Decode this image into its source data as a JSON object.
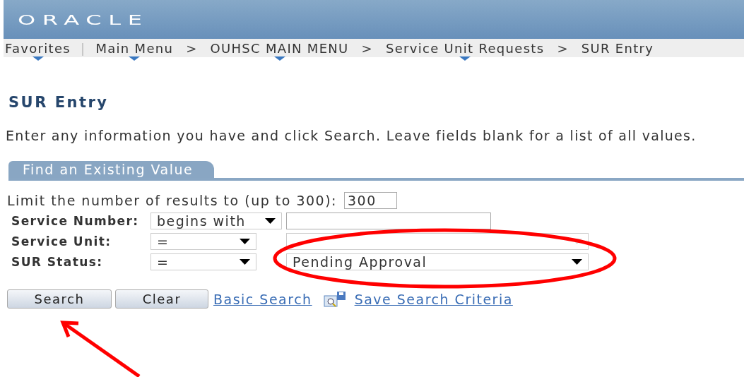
{
  "header": {
    "logo": "ORACLE"
  },
  "nav": [
    {
      "label": "Favorites",
      "menu": true,
      "separator": "|"
    },
    {
      "label": "Main Menu",
      "menu": true,
      "separator": ">"
    },
    {
      "label": "OUHSC MAIN MENU",
      "menu": true,
      "separator": ">"
    },
    {
      "label": "Service Unit Requests",
      "menu": true,
      "separator": ">"
    },
    {
      "label": "SUR Entry",
      "menu": false
    }
  ],
  "page_title": "SUR Entry",
  "instructions": "Enter any information you have and click Search. Leave fields blank for a list of all values.",
  "tabs": [
    {
      "label": "Find an Existing Value",
      "selected": true
    }
  ],
  "limit": {
    "label": "Limit the number of results to (up to 300):",
    "value": "300"
  },
  "criteria": [
    {
      "label": "Service Number:",
      "operator": "begins with",
      "kind": "text"
    },
    {
      "label": "Service Unit:",
      "operator": "=",
      "kind": "select"
    },
    {
      "label": "SUR Status:",
      "operator": "=",
      "kind": "select",
      "value": "Pending Approval"
    }
  ],
  "buttons": [
    {
      "label": "Search"
    },
    {
      "label": "Clear"
    }
  ],
  "links": [
    {
      "label": "Basic Search",
      "icon": false
    },
    {
      "label": "Save Search Criteria",
      "icon": true
    }
  ],
  "annotations": [
    {
      "kind": "ellipse"
    },
    {
      "kind": "arrow"
    }
  ]
}
